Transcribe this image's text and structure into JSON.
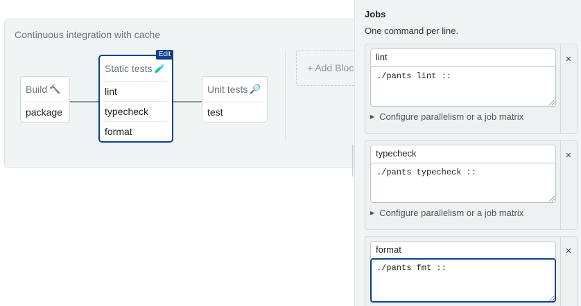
{
  "pipeline": {
    "title": "Continuous integration with cache",
    "add_block_label": "+ Add Block",
    "edit_tag": "Edit",
    "blocks": [
      {
        "title": "Build",
        "emoji": "🔨",
        "jobs": [
          "package"
        ]
      },
      {
        "title": "Static tests",
        "emoji": "🧪",
        "jobs": [
          "lint",
          "typecheck",
          "format"
        ]
      },
      {
        "title": "Unit tests",
        "emoji": "🔎",
        "jobs": [
          "test"
        ]
      }
    ]
  },
  "panel": {
    "title": "Jobs",
    "subtitle": "One command per line.",
    "parallel_label": "Configure parallelism or a job matrix",
    "remove_icon": "×",
    "jobs": [
      {
        "name": "lint",
        "command": "./pants lint ::"
      },
      {
        "name": "typecheck",
        "command": "./pants typecheck ::"
      },
      {
        "name": "format",
        "command": "./pants fmt ::"
      }
    ]
  },
  "colors": {
    "accent": "#10418e",
    "canvas": "#f1f4f5"
  }
}
